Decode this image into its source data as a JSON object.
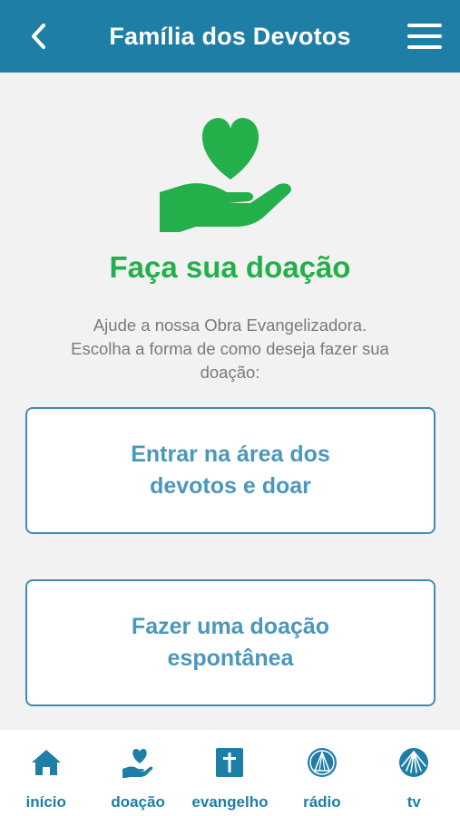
{
  "header": {
    "title": "Família dos Devotos",
    "back_icon": "chevron-left-icon",
    "menu_icon": "hamburger-menu-icon",
    "background_color": "#1f7ea6"
  },
  "hero": {
    "icon": "heart-in-hand-icon",
    "heading": "Faça sua doação",
    "intro": "Ajude a nossa Obra Evangelizadora.\nEscolha a forma de como deseja fazer sua doação:",
    "accent_color": "#23b04b"
  },
  "options": [
    {
      "label": "Entrar na área dos\ndevotos e doar"
    },
    {
      "label": "Fazer uma doação\nespontânea"
    }
  ],
  "bottom_nav": {
    "items": [
      {
        "label": "início",
        "icon": "home-icon"
      },
      {
        "label": "doação",
        "icon": "heart-hand-icon"
      },
      {
        "label": "evangelho",
        "icon": "bible-icon"
      },
      {
        "label": "rádio",
        "icon": "radio-logo-icon"
      },
      {
        "label": "tv",
        "icon": "tv-logo-icon"
      }
    ],
    "color": "#1f7ea6"
  }
}
